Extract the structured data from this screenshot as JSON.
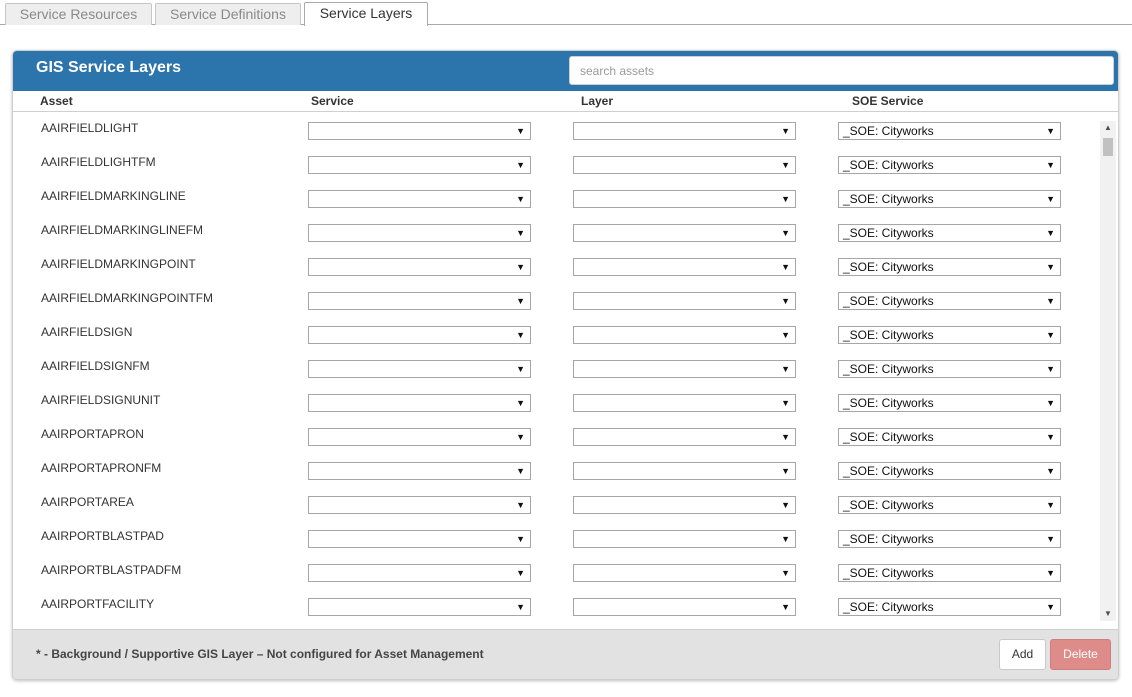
{
  "tabs": [
    {
      "label": "Service Resources",
      "active": false
    },
    {
      "label": "Service Definitions",
      "active": false
    },
    {
      "label": "Service Layers",
      "active": true
    }
  ],
  "panel": {
    "title": "GIS Service Layers",
    "search_placeholder": "search assets",
    "search_value": "",
    "columns": [
      "Asset",
      "Service",
      "Layer",
      "SOE Service"
    ]
  },
  "rows": [
    {
      "asset": "AAIRFIELDLIGHT",
      "service": "",
      "layer": "",
      "soe_service": "_SOE: Cityworks"
    },
    {
      "asset": "AAIRFIELDLIGHTFM",
      "service": "",
      "layer": "",
      "soe_service": "_SOE: Cityworks"
    },
    {
      "asset": "AAIRFIELDMARKINGLINE",
      "service": "",
      "layer": "",
      "soe_service": "_SOE: Cityworks"
    },
    {
      "asset": "AAIRFIELDMARKINGLINEFM",
      "service": "",
      "layer": "",
      "soe_service": "_SOE: Cityworks"
    },
    {
      "asset": "AAIRFIELDMARKINGPOINT",
      "service": "",
      "layer": "",
      "soe_service": "_SOE: Cityworks"
    },
    {
      "asset": "AAIRFIELDMARKINGPOINTFM",
      "service": "",
      "layer": "",
      "soe_service": "_SOE: Cityworks"
    },
    {
      "asset": "AAIRFIELDSIGN",
      "service": "",
      "layer": "",
      "soe_service": "_SOE: Cityworks"
    },
    {
      "asset": "AAIRFIELDSIGNFM",
      "service": "",
      "layer": "",
      "soe_service": "_SOE: Cityworks"
    },
    {
      "asset": "AAIRFIELDSIGNUNIT",
      "service": "",
      "layer": "",
      "soe_service": "_SOE: Cityworks"
    },
    {
      "asset": "AAIRPORTAPRON",
      "service": "",
      "layer": "",
      "soe_service": "_SOE: Cityworks"
    },
    {
      "asset": "AAIRPORTAPRONFM",
      "service": "",
      "layer": "",
      "soe_service": "_SOE: Cityworks"
    },
    {
      "asset": "AAIRPORTAREA",
      "service": "",
      "layer": "",
      "soe_service": "_SOE: Cityworks"
    },
    {
      "asset": "AAIRPORTBLASTPAD",
      "service": "",
      "layer": "",
      "soe_service": "_SOE: Cityworks"
    },
    {
      "asset": "AAIRPORTBLASTPADFM",
      "service": "",
      "layer": "",
      "soe_service": "_SOE: Cityworks"
    },
    {
      "asset": "AAIRPORTFACILITY",
      "service": "",
      "layer": "",
      "soe_service": "_SOE: Cityworks"
    }
  ],
  "footer": {
    "note": "* - Background / Supportive GIS Layer – Not configured for Asset Management",
    "add_label": "Add",
    "delete_label": "Delete"
  },
  "icons": {
    "dropdown_arrow": "chevron-down-icon",
    "scroll_up": "scroll-up-arrow-icon",
    "scroll_down": "scroll-down-arrow-icon"
  },
  "colors": {
    "header_blue": "#2b74ac",
    "delete_button": "#de8c8a",
    "footer_bg": "#e2e2e2"
  }
}
